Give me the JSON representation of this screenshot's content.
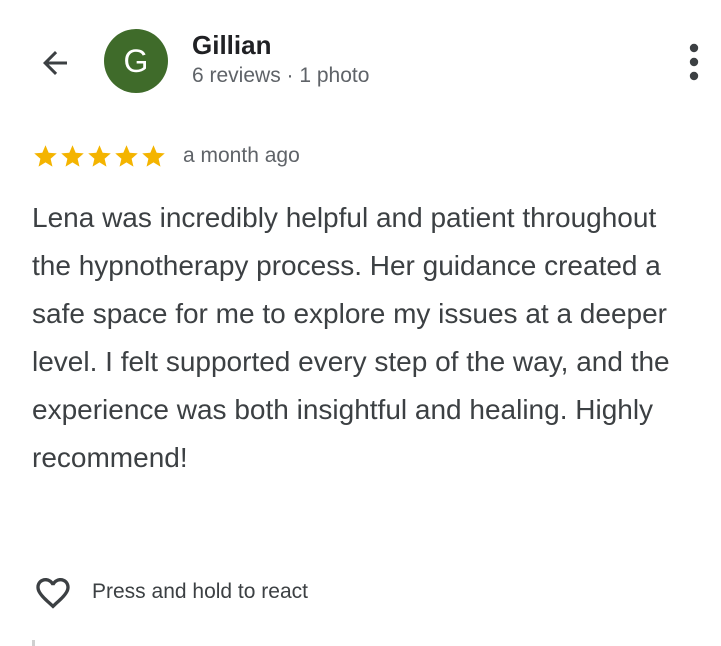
{
  "header": {
    "back_icon": "arrow-left-icon",
    "more_icon": "more-vertical-icon"
  },
  "reviewer": {
    "initial": "G",
    "name": "Gillian",
    "meta": "6 reviews · 1 photo",
    "avatar_color": "#3f6b2a"
  },
  "review": {
    "rating": 5,
    "rating_max": 5,
    "star_color": "#f4b400",
    "time": "a month ago",
    "text": "Lena was incredibly helpful and patient throughout the hypnotherapy process. Her guidance created a safe space for me to explore my issues at a deeper level. I felt supported every step of the way, and the experience was both insightful and healing. Highly recommend!"
  },
  "reaction": {
    "icon": "heart-outline-icon",
    "label": "Press and hold to react"
  }
}
